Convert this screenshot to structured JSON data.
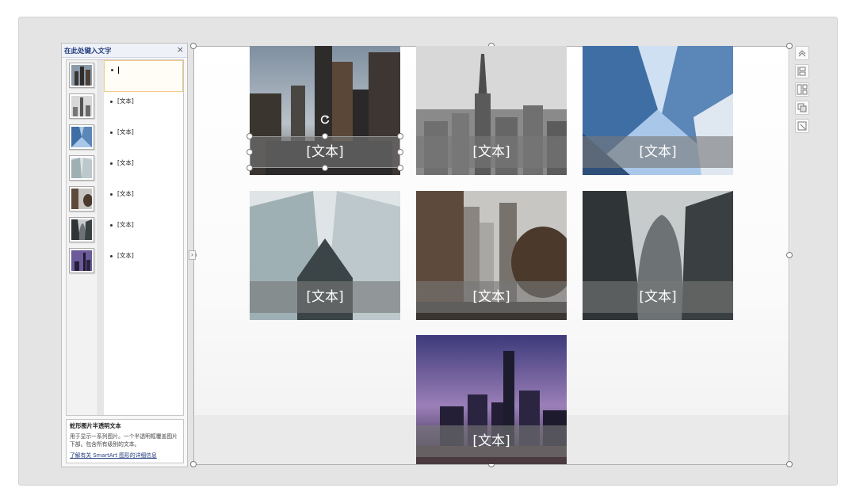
{
  "text_pane": {
    "title": "在此处键入文字",
    "close_glyph": "×",
    "rows": [
      {
        "text": ""
      },
      {
        "text": "[文本]"
      },
      {
        "text": "[文本]"
      },
      {
        "text": "[文本]"
      },
      {
        "text": "[文本]"
      },
      {
        "text": "[文本]"
      },
      {
        "text": "[文本]"
      }
    ],
    "info": {
      "title": "蛇形图片半透明文本",
      "description": "用于显示一系列图片。一个半透明框覆盖图片下部。包含所有级别的文本。",
      "link": "了解有关 SmartArt 图形的详细信息"
    },
    "collapse_glyph": "›"
  },
  "smartart": {
    "tiles": [
      {
        "label": "[文本]",
        "scene": "dusk-towers"
      },
      {
        "label": "[文本]",
        "scene": "empire-state-bw"
      },
      {
        "label": "[文本]",
        "scene": "glass-sky-up"
      },
      {
        "label": "[文本]",
        "scene": "glass-facade-up"
      },
      {
        "label": "[文本]",
        "scene": "street-canyon"
      },
      {
        "label": "[文本]",
        "scene": "curved-tower-bw"
      },
      {
        "label": "[文本]",
        "scene": "night-skyline"
      }
    ]
  },
  "side_toolbar": {
    "items": [
      "move-up-icon",
      "move-order-icon",
      "layout-icon",
      "style-icon",
      "resize-icon"
    ]
  },
  "colors": {
    "overlay": "#787878",
    "accent_selection": "#f1c98a",
    "pane_title": "#1f3a7a"
  }
}
